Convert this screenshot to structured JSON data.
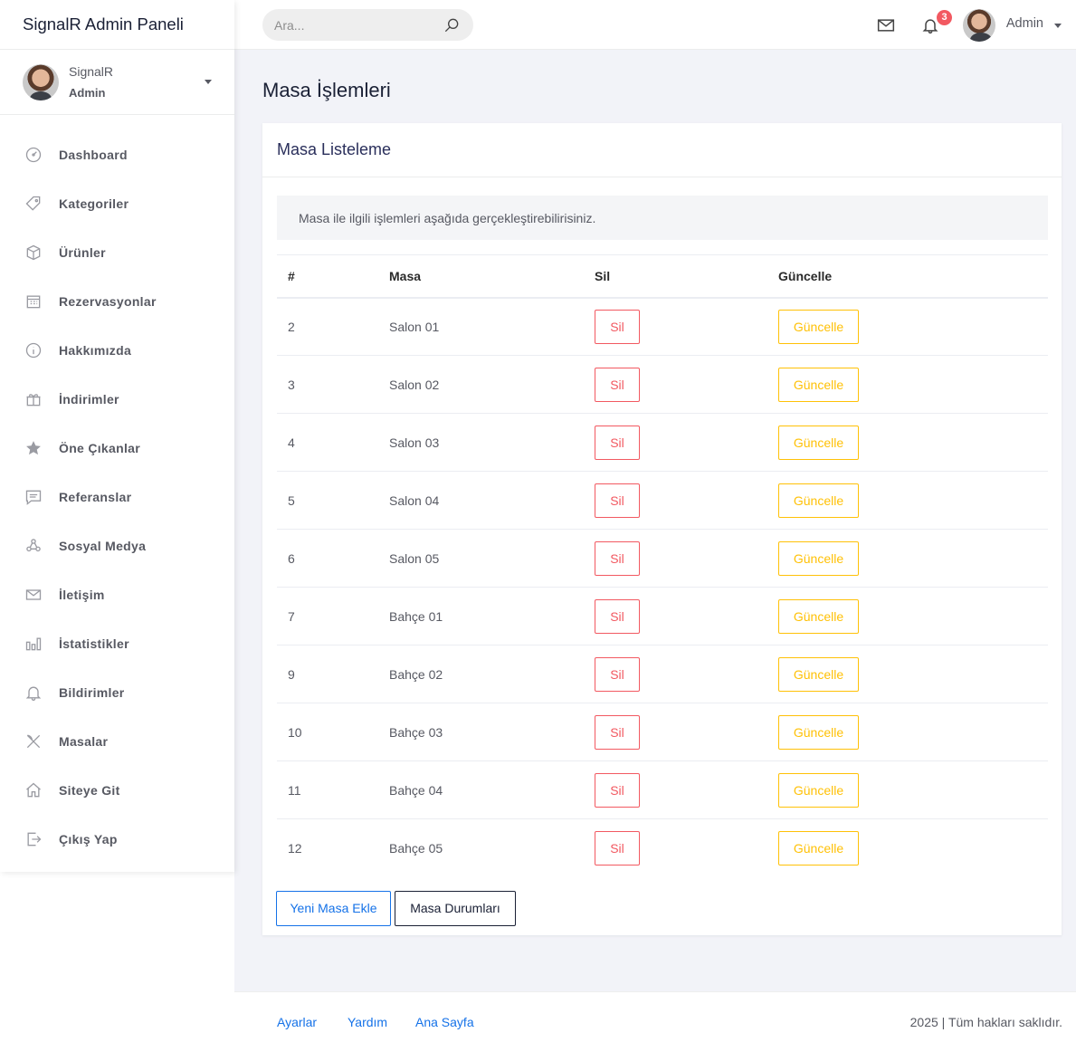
{
  "brand": "SignalR Admin Paneli",
  "user": {
    "name": "SignalR",
    "role": "Admin"
  },
  "menu": [
    {
      "label": "Dashboard",
      "icon": "dashboard-icon"
    },
    {
      "label": "Kategoriler",
      "icon": "tag-icon"
    },
    {
      "label": "Ürünler",
      "icon": "box-icon"
    },
    {
      "label": "Rezervasyonlar",
      "icon": "calendar-icon"
    },
    {
      "label": "Hakkımızda",
      "icon": "info-icon"
    },
    {
      "label": "İndirimler",
      "icon": "gift-icon"
    },
    {
      "label": "Öne Çıkanlar",
      "icon": "star-icon"
    },
    {
      "label": "Referanslar",
      "icon": "comment-icon"
    },
    {
      "label": "Sosyal Medya",
      "icon": "share-icon"
    },
    {
      "label": "İletişim",
      "icon": "envelope-icon"
    },
    {
      "label": "İstatistikler",
      "icon": "chart-icon"
    },
    {
      "label": "Bildirimler",
      "icon": "bell-icon"
    },
    {
      "label": "Masalar",
      "icon": "utensils-icon"
    },
    {
      "label": "Siteye Git",
      "icon": "home-icon"
    },
    {
      "label": "Çıkış Yap",
      "icon": "logout-icon"
    }
  ],
  "topbar": {
    "search_placeholder": "Ara...",
    "notification_count": "3",
    "user_label": "Admin"
  },
  "page": {
    "title": "Masa İşlemleri",
    "card_title": "Masa Listeleme",
    "info": "Masa ile ilgili işlemleri aşağıda gerçekleştirebilirisiniz."
  },
  "table": {
    "headers": [
      "#",
      "Masa",
      "Sil",
      "Güncelle"
    ],
    "rows": [
      {
        "id": "2",
        "name": "Salon 01",
        "delete": "Sil",
        "update": "Güncelle"
      },
      {
        "id": "3",
        "name": "Salon 02",
        "delete": "Sil",
        "update": "Güncelle"
      },
      {
        "id": "4",
        "name": "Salon 03",
        "delete": "Sil",
        "update": "Güncelle"
      },
      {
        "id": "5",
        "name": "Salon 04",
        "delete": "Sil",
        "update": "Güncelle"
      },
      {
        "id": "6",
        "name": "Salon 05",
        "delete": "Sil",
        "update": "Güncelle"
      },
      {
        "id": "7",
        "name": "Bahçe 01",
        "delete": "Sil",
        "update": "Güncelle"
      },
      {
        "id": "9",
        "name": "Bahçe 02",
        "delete": "Sil",
        "update": "Güncelle"
      },
      {
        "id": "10",
        "name": "Bahçe 03",
        "delete": "Sil",
        "update": "Güncelle"
      },
      {
        "id": "11",
        "name": "Bahçe 04",
        "delete": "Sil",
        "update": "Güncelle"
      },
      {
        "id": "12",
        "name": "Bahçe 05",
        "delete": "Sil",
        "update": "Güncelle"
      }
    ]
  },
  "actions": {
    "new_table": "Yeni Masa Ekle",
    "table_status": "Masa Durumları"
  },
  "footer": {
    "links": [
      "Ayarlar",
      "Yardım",
      "Ana Sayfa"
    ],
    "copyright": "2025 | Tüm hakları saklıdır."
  },
  "colors": {
    "primary": "#1572e8",
    "danger": "#f25961",
    "warning": "#ffc107",
    "dark": "#1a2035",
    "background": "#f2f3f8"
  }
}
